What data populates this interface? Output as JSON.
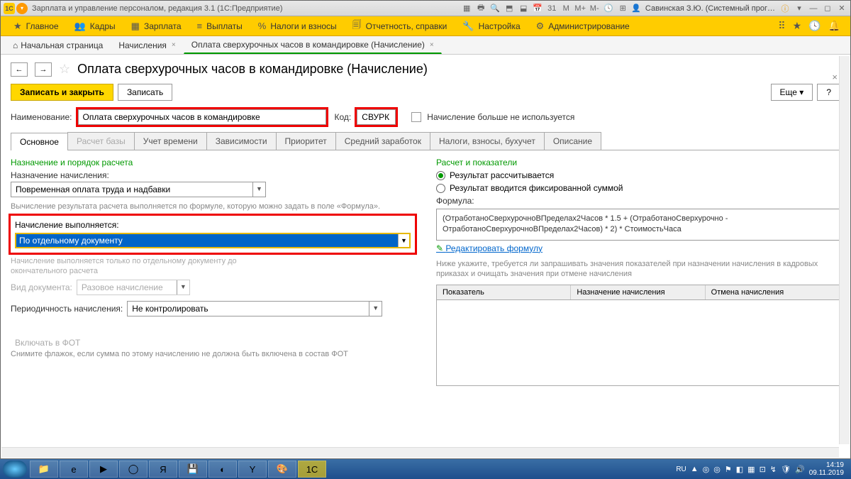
{
  "titlebar": {
    "app_title": "Зарплата и управление персоналом, редакция 3.1  (1С:Предприятие)",
    "user": "Савинская З.Ю. (Системный прог…"
  },
  "menu": {
    "items": [
      {
        "icon": "★",
        "label": "Главное"
      },
      {
        "icon": "👥",
        "label": "Кадры"
      },
      {
        "icon": "▦",
        "label": "Зарплата"
      },
      {
        "icon": "≡",
        "label": "Выплаты"
      },
      {
        "icon": "%",
        "label": "Налоги и взносы"
      },
      {
        "icon": "🗐",
        "label": "Отчетность, справки"
      },
      {
        "icon": "🔧",
        "label": "Настройка"
      },
      {
        "icon": "⚙",
        "label": "Администрирование"
      }
    ]
  },
  "breadcrumbs": {
    "home": "Начальная страница",
    "tab1": "Начисления",
    "tab2": "Оплата сверхурочных часов в командировке (Начисление)"
  },
  "page": {
    "title": "Оплата сверхурочных часов в командировке (Начисление)",
    "save_close": "Записать и закрыть",
    "save": "Записать",
    "more": "Еще",
    "help": "?"
  },
  "fields": {
    "name_label": "Наименование:",
    "name_value": "Оплата сверхурочных часов в командировке",
    "code_label": "Код:",
    "code_value": "СВУРК",
    "not_used": "Начисление больше не используется"
  },
  "tabs2": [
    "Основное",
    "Расчет базы",
    "Учет времени",
    "Зависимости",
    "Приоритет",
    "Средний заработок",
    "Налоги, взносы, бухучет",
    "Описание"
  ],
  "left": {
    "sec": "Назначение и порядок расчета",
    "l1": "Назначение начисления:",
    "v1": "Повременная оплата труда и надбавки",
    "hint1": "Вычисление результата расчета выполняется по формуле, которую можно задать в поле «Формула».",
    "l2": "Начисление выполняется:",
    "v2": "По отдельному документу",
    "hint2a": "Начисление выполняется только по отдельному документу до",
    "hint2b": "окончательного расчета",
    "doc_label": "Вид документа:",
    "doc_value": "Разовое начисление",
    "period_label": "Периодичность начисления:",
    "period_value": "Не контролировать",
    "fot_chk": "Включать в ФОТ",
    "fot_hint": "Снимите флажок, если сумма по этому начислению не должна быть включена в состав ФОТ"
  },
  "right": {
    "sec": "Расчет и показатели",
    "r1": "Результат рассчитывается",
    "r2": "Результат вводится фиксированной суммой",
    "formula_label": "Формула:",
    "formula": "(ОтработаноСверхурочноВПределах2Часов * 1.5 + (ОтработаноСверхурочно - ОтработаноСверхурочноВПределах2Часов) * 2) * СтоимостьЧаса",
    "edit": "Редактировать формулу",
    "hint": "Ниже укажите, требуется ли запрашивать значения показателей при назначении начисления в кадровых приказах и очищать значения при отмене начисления",
    "cols": [
      "Показатель",
      "Назначение начисления",
      "Отмена начисления"
    ]
  },
  "tray": {
    "lang": "RU",
    "time": "14:19",
    "date": "09.11.2019"
  }
}
